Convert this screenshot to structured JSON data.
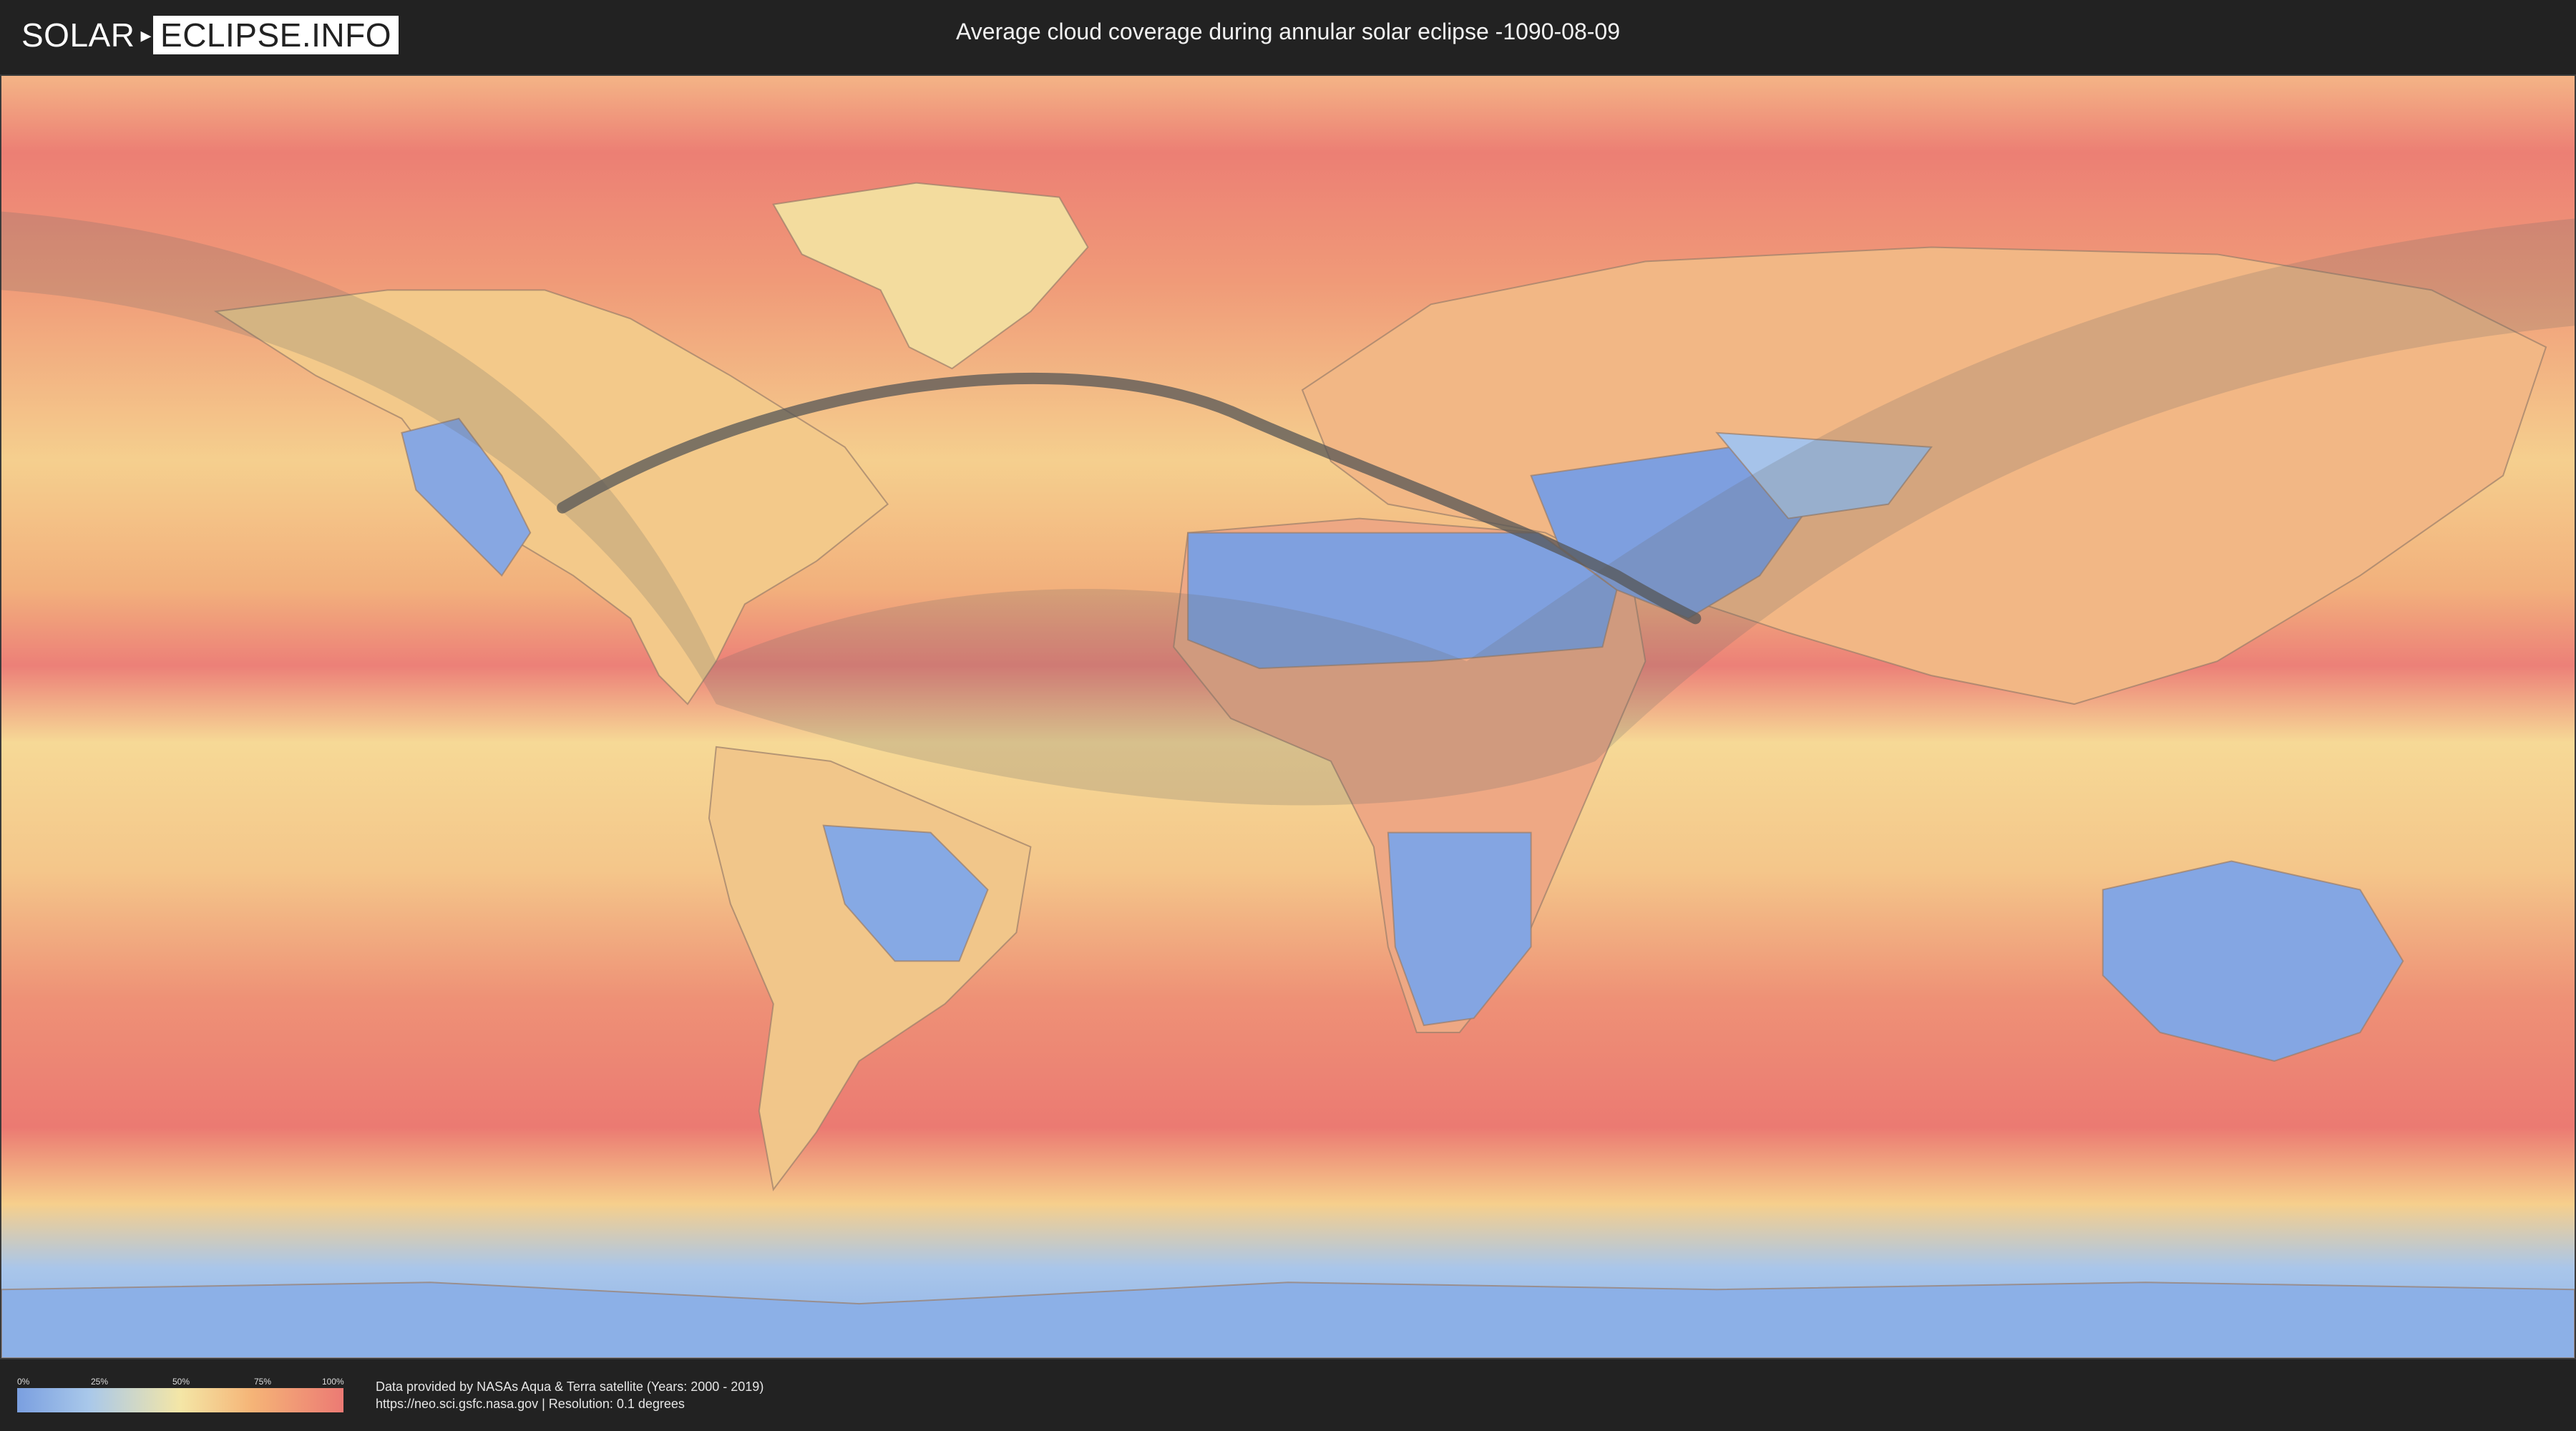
{
  "header": {
    "logo_part1": "SOLAR",
    "logo_part2": "ECLIPSE.INFO",
    "title": "Average cloud coverage during annular solar eclipse -1090-08-09"
  },
  "map": {
    "layer": "average cloud coverage",
    "features": [
      "eclipse-visibility-zone",
      "annular-eclipse-path",
      "country-borders",
      "coastlines"
    ],
    "colors": {
      "clear": "#7a9fe0",
      "low": "#a9c8ea",
      "mid": "#f4e6a6",
      "high": "#f5b477",
      "overcast": "#ec7a74",
      "path": "#555555",
      "visibility_zone": "#6b6b6b"
    }
  },
  "legend": {
    "ticks": [
      "0%",
      "25%",
      "50%",
      "75%",
      "100%"
    ]
  },
  "credits": {
    "line1": "Data provided by NASAs Aqua & Terra satellite (Years: 2000 - 2019)",
    "line2": "https://neo.sci.gsfc.nasa.gov | Resolution: 0.1 degrees"
  }
}
